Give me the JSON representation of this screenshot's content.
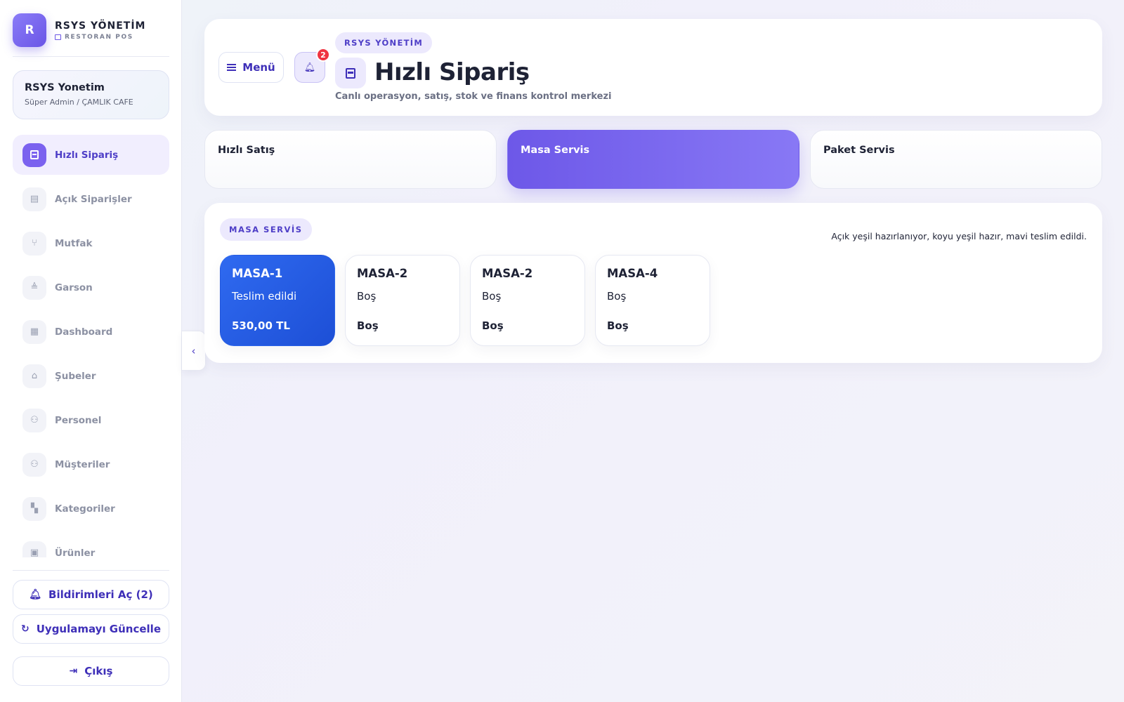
{
  "sidebar": {
    "brand": {
      "logo_letter": "R",
      "name": "RSYS YÖNETİM",
      "subtitle": "RESTORAN POS"
    },
    "user": {
      "name": "RSYS Yonetim",
      "role": "Süper Admin / ÇAMLIK CAFE"
    },
    "items": [
      {
        "label": "Hızlı Sipariş",
        "icon": "receipt-icon",
        "active": true
      },
      {
        "label": "Açık Siparişler",
        "icon": "document-icon"
      },
      {
        "label": "Mutfak",
        "icon": "utensils-icon"
      },
      {
        "label": "Garson",
        "icon": "waiter-icon"
      },
      {
        "label": "Dashboard",
        "icon": "dashboard-icon"
      },
      {
        "label": "Şubeler",
        "icon": "branch-icon"
      },
      {
        "label": "Personel",
        "icon": "people-icon"
      },
      {
        "label": "Müşteriler",
        "icon": "people-icon"
      },
      {
        "label": "Kategoriler",
        "icon": "grid-icon"
      },
      {
        "label": "Ürünler",
        "icon": "product-icon"
      }
    ],
    "notifications_button": "Bildirimleri Aç (2)",
    "update_button": "Uygulamayı Güncelle",
    "logout_button": "Çıkış"
  },
  "header": {
    "menu_label": "Menü",
    "notification_count": "2",
    "kicker": "RSYS YÖNETİM",
    "title": "Hızlı Sipariş",
    "subtitle": "Canlı operasyon, satış, stok ve finans kontrol merkezi"
  },
  "modes": [
    {
      "label": "Hızlı Satış",
      "active": false
    },
    {
      "label": "Masa Servis",
      "active": true
    },
    {
      "label": "Paket Servis",
      "active": false
    }
  ],
  "panel": {
    "tag": "MASA SERVİS",
    "hint": "Açık yeşil hazırlanıyor, koyu yeşil hazır, mavi teslim edildi.",
    "tables": [
      {
        "name": "MASA-1",
        "status": "Teslim edildi",
        "total": "530,00 TL",
        "state": "delivered"
      },
      {
        "name": "MASA-2",
        "status": "Boş",
        "total": "Boş",
        "state": "empty"
      },
      {
        "name": "MASA-2",
        "status": "Boş",
        "total": "Boş",
        "state": "empty"
      },
      {
        "name": "MASA-4",
        "status": "Boş",
        "total": "Boş",
        "state": "empty"
      }
    ]
  },
  "colors": {
    "accent": "#6d58e8",
    "delivered": "#2f6af0",
    "badge": "#ef3340"
  }
}
